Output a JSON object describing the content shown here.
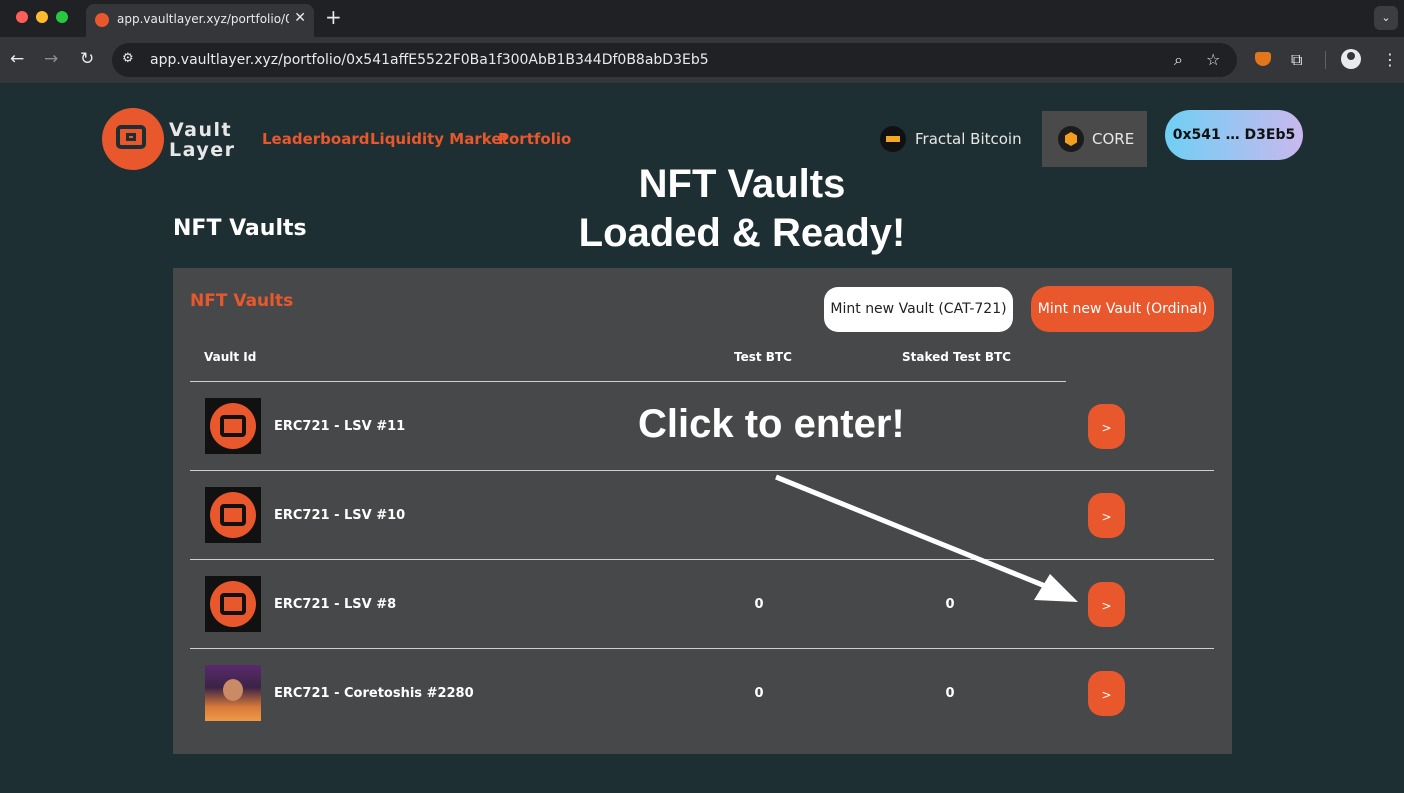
{
  "browser": {
    "tab_title": "app.vaultlayer.xyz/portfolio/0",
    "url": "app.vaultlayer.xyz/portfolio/0x541affE5522F0Ba1f300AbB1B344Df0B8abD3Eb5",
    "icons": [
      "close-icon",
      "plus-icon",
      "back-icon",
      "forward-icon",
      "reload-icon",
      "site-info-icon",
      "zoom-icon",
      "star-icon",
      "metamask-icon",
      "extensions-icon",
      "profile-icon",
      "menu-icon"
    ]
  },
  "header": {
    "logo_line1": "Vault",
    "logo_line2": "Layer",
    "nav": [
      "Leaderboard",
      "Liquidity Market",
      "Portfolio"
    ],
    "network_fractal": "Fractal Bitcoin",
    "network_core": "CORE",
    "wallet": "0x541 … D3Eb5",
    "accent": "#e8582c"
  },
  "annotations": {
    "banner_line1": "NFT Vaults",
    "banner_line2": "Loaded & Ready!",
    "click": "Click to enter!"
  },
  "page": {
    "title": "NFT Vaults"
  },
  "panel": {
    "title": "NFT Vaults",
    "mint_cat": "Mint new Vault (CAT-721)",
    "mint_ordinal": "Mint new Vault (Ordinal)",
    "columns": [
      "Vault Id",
      "Test BTC",
      "Staked Test BTC"
    ],
    "rows": [
      {
        "name": "ERC721 - LSV #11",
        "test_btc": "",
        "staked": "",
        "enter": ">",
        "thumb": "vaultlayer-logo"
      },
      {
        "name": "ERC721 - LSV #10",
        "test_btc": "",
        "staked": "",
        "enter": ">",
        "thumb": "vaultlayer-logo"
      },
      {
        "name": "ERC721 - LSV #8",
        "test_btc": "0",
        "staked": "0",
        "enter": ">",
        "thumb": "vaultlayer-logo"
      },
      {
        "name": "ERC721 - Coretoshis #2280",
        "test_btc": "0",
        "staked": "0",
        "enter": ">",
        "thumb": "coretoshi-avatar"
      }
    ]
  }
}
